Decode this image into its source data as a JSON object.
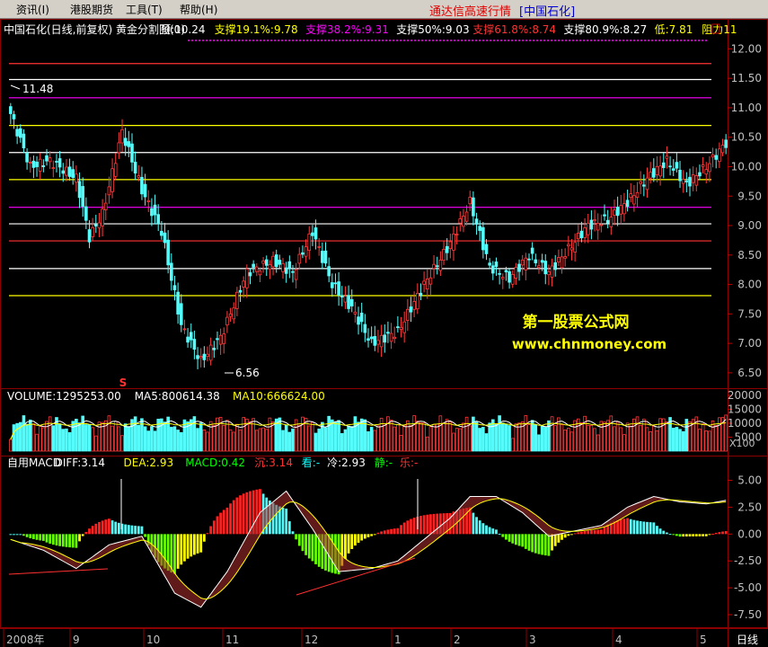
{
  "menu": {
    "items": [
      "资讯(I)",
      "港股期货",
      "工具(T)",
      "帮助(H)"
    ],
    "brand": "通达信高速行情",
    "brand_stock": "[中国石化]"
  },
  "price_header": [
    {
      "text": "中国石化(日线,前复权) 黄金分割图(0)",
      "color": "#ffffff"
    },
    {
      "text": "顶:10.24",
      "color": "#ffffff"
    },
    {
      "text": "支撑19.1%:9.78",
      "color": "#ffff00"
    },
    {
      "text": "支撑38.2%:9.31",
      "color": "#ff00ff"
    },
    {
      "text": "支撑50%:9.03",
      "color": "#ffffff"
    },
    {
      "text": "支撑61.8%:8.74",
      "color": "#ff3333"
    },
    {
      "text": "支撑80.9%:8.27",
      "color": "#ffffff"
    },
    {
      "text": "低:7.81",
      "color": "#ffff00"
    },
    {
      "text": "阻力11",
      "color": "#ffff00"
    }
  ],
  "volume_header": [
    {
      "text": "VOLUME:1295253.00",
      "color": "#ffffff"
    },
    {
      "text": "MA5:800614.38",
      "color": "#ffffff"
    },
    {
      "text": "MA10:666624.00",
      "color": "#ffff00"
    }
  ],
  "macd_header": [
    {
      "text": "自用MACD",
      "color": "#ffffff"
    },
    {
      "text": "DIFF:3.14",
      "color": "#ffffff"
    },
    {
      "text": "DEA:2.93",
      "color": "#ffff00"
    },
    {
      "text": "MACD:0.42",
      "color": "#00ff00"
    },
    {
      "text": "沉:3.14",
      "color": "#ff3333"
    },
    {
      "text": "看:-",
      "color": "#00ffff"
    },
    {
      "text": "冷:2.93",
      "color": "#ffffff"
    },
    {
      "text": "静:-",
      "color": "#00ff00"
    },
    {
      "text": "乐:-",
      "color": "#ff3333"
    }
  ],
  "watermark": {
    "line1": "第一股票公式网",
    "line2": "www.chnmoney.com"
  },
  "annotations": {
    "high": "11.48",
    "low": "6.56",
    "marker": "S"
  },
  "time_axis": {
    "labels": [
      "2008年",
      "9",
      "10",
      "11",
      "12",
      "1",
      "2",
      "3",
      "4",
      "5"
    ],
    "period": "日线"
  },
  "volume_unit": "X100",
  "chart_data": {
    "type": "candlestick",
    "price_ticks": [
      12.0,
      11.5,
      11.0,
      10.5,
      10.0,
      9.5,
      9.0,
      8.5,
      8.0,
      7.5,
      7.0,
      6.5
    ],
    "price_ylim": [
      6.3,
      12.25
    ],
    "levels": [
      {
        "value": 11.75,
        "color": "#ff3333"
      },
      {
        "value": 11.48,
        "color": "#ffffff"
      },
      {
        "value": 11.17,
        "color": "#ff00ff"
      },
      {
        "value": 10.7,
        "color": "#ffff00"
      },
      {
        "value": 10.24,
        "color": "#ffffff"
      },
      {
        "value": 9.78,
        "color": "#ffff00"
      },
      {
        "value": 9.31,
        "color": "#ff00ff"
      },
      {
        "value": 9.03,
        "color": "#ffffff"
      },
      {
        "value": 8.74,
        "color": "#ff3333"
      },
      {
        "value": 8.27,
        "color": "#ffffff"
      },
      {
        "value": 7.81,
        "color": "#ffff00"
      }
    ],
    "close_anchors": [
      [
        0,
        10.9
      ],
      [
        6,
        10.0
      ],
      [
        12,
        10.1
      ],
      [
        20,
        9.8
      ],
      [
        24,
        8.8
      ],
      [
        28,
        9.2
      ],
      [
        34,
        10.6
      ],
      [
        40,
        9.6
      ],
      [
        46,
        8.9
      ],
      [
        52,
        7.3
      ],
      [
        58,
        6.7
      ],
      [
        64,
        7.1
      ],
      [
        72,
        8.2
      ],
      [
        80,
        8.4
      ],
      [
        86,
        8.2
      ],
      [
        92,
        8.9
      ],
      [
        98,
        8.0
      ],
      [
        104,
        7.6
      ],
      [
        110,
        7.0
      ],
      [
        118,
        7.2
      ],
      [
        126,
        8.0
      ],
      [
        134,
        8.7
      ],
      [
        140,
        9.4
      ],
      [
        146,
        8.3
      ],
      [
        152,
        8.1
      ],
      [
        158,
        8.5
      ],
      [
        164,
        8.2
      ],
      [
        170,
        8.6
      ],
      [
        176,
        9.0
      ],
      [
        182,
        9.1
      ],
      [
        188,
        9.4
      ],
      [
        194,
        9.8
      ],
      [
        200,
        10.1
      ],
      [
        206,
        9.7
      ],
      [
        212,
        10.0
      ],
      [
        218,
        10.4
      ]
    ],
    "volume_ticks": [
      20000,
      15000,
      10000,
      5000
    ],
    "volume_ylim": [
      0,
      21000
    ],
    "macd_ticks": [
      5.0,
      2.5,
      0.0,
      -2.5,
      -5.0,
      -7.5
    ],
    "macd_ylim": [
      -8.5,
      6.8
    ],
    "diff_anchors": [
      [
        0,
        -0.5
      ],
      [
        10,
        -1.5
      ],
      [
        20,
        -3.2
      ],
      [
        30,
        -1.0
      ],
      [
        40,
        -0.2
      ],
      [
        50,
        -5.5
      ],
      [
        58,
        -6.8
      ],
      [
        66,
        -3.5
      ],
      [
        76,
        2.0
      ],
      [
        84,
        4.0
      ],
      [
        92,
        0.5
      ],
      [
        100,
        -3.5
      ],
      [
        110,
        -3.2
      ],
      [
        118,
        -2.5
      ],
      [
        126,
        -0.5
      ],
      [
        134,
        1.5
      ],
      [
        140,
        3.5
      ],
      [
        148,
        3.5
      ],
      [
        156,
        2.0
      ],
      [
        164,
        -0.2
      ],
      [
        172,
        0.3
      ],
      [
        180,
        0.8
      ],
      [
        188,
        2.5
      ],
      [
        196,
        3.5
      ],
      [
        204,
        3.0
      ],
      [
        212,
        2.8
      ],
      [
        218,
        3.14
      ]
    ]
  }
}
